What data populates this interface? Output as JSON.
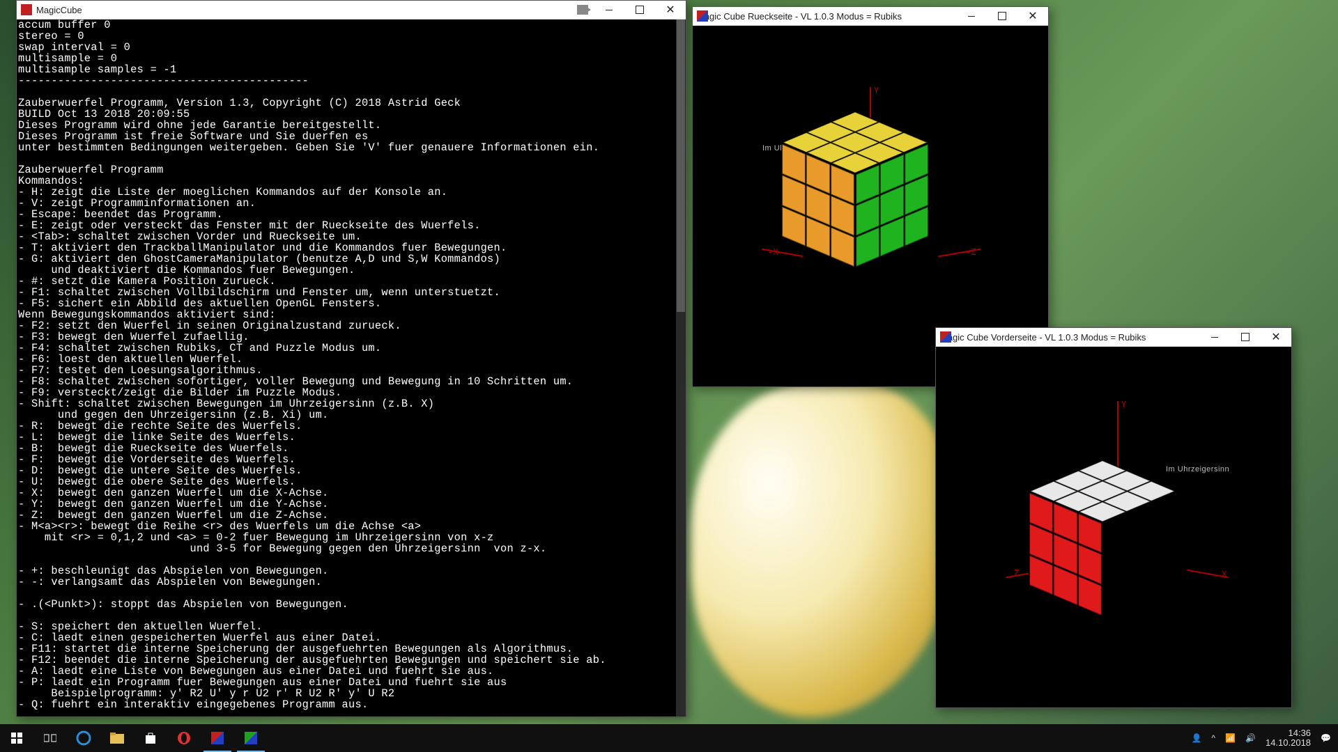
{
  "console_window": {
    "title": "MagicCube",
    "text": "accum buffer 0\nstereo = 0\nswap interval = 0\nmultisample = 0\nmultisample samples = -1\n--------------------------------------------\n\nZauberwuerfel Programm, Version 1.3, Copyright (C) 2018 Astrid Geck\nBUILD Oct 13 2018 20:09:55\nDieses Programm wird ohne jede Garantie bereitgestellt.\nDieses Programm ist freie Software und Sie duerfen es\nunter bestimmten Bedingungen weitergeben. Geben Sie 'V' fuer genauere Informationen ein.\n\nZauberwuerfel Programm\nKommandos:\n- H: zeigt die Liste der moeglichen Kommandos auf der Konsole an.\n- V: zeigt Programminformationen an.\n- Escape: beendet das Programm.\n- E: zeigt oder versteckt das Fenster mit der Rueckseite des Wuerfels.\n- <Tab>: schaltet zwischen Vorder und Rueckseite um.\n- T: aktiviert den TrackballManipulator und die Kommandos fuer Bewegungen.\n- G: aktiviert den GhostCameraManipulator (benutze A,D und S,W Kommandos)\n     und deaktiviert die Kommandos fuer Bewegungen.\n- #: setzt die Kamera Position zurueck.\n- F1: schaltet zwischen Vollbildschirm und Fenster um, wenn unterstuetzt.\n- F5: sichert ein Abbild des aktuellen OpenGL Fensters.\nWenn Bewegungskommandos aktiviert sind:\n- F2: setzt den Wuerfel in seinen Originalzustand zurueck.\n- F3: bewegt den Wuerfel zufaellig.\n- F4: schaltet zwischen Rubiks, CT and Puzzle Modus um.\n- F6: loest den aktuellen Wuerfel.\n- F7: testet den Loesungsalgorithmus.\n- F8: schaltet zwischen sofortiger, voller Bewegung und Bewegung in 10 Schritten um.\n- F9: versteckt/zeigt die Bilder im Puzzle Modus.\n- Shift: schaltet zwischen Bewegungen im Uhrzeigersinn (z.B. X)\n      und gegen den Uhrzeigersinn (z.B. Xi) um.\n- R:  bewegt die rechte Seite des Wuerfels.\n- L:  bewegt die linke Seite des Wuerfels.\n- B:  bewegt die Rueckseite des Wuerfels.\n- F:  bewegt die Vorderseite des Wuerfels.\n- D:  bewegt die untere Seite des Wuerfels.\n- U:  bewegt die obere Seite des Wuerfels.\n- X:  bewegt den ganzen Wuerfel um die X-Achse.\n- Y:  bewegt den ganzen Wuerfel um die Y-Achse.\n- Z:  bewegt den ganzen Wuerfel um die Z-Achse.\n- M<a><r>: bewegt die Reihe <r> des Wuerfels um die Achse <a>\n    mit <r> = 0,1,2 und <a> = 0-2 fuer Bewegung im Uhrzeigersinn von x-z\n                          und 3-5 for Bewegung gegen den Uhrzeigersinn  von z-x.\n\n- +: beschleunigt das Abspielen von Bewegungen.\n- -: verlangsamt das Abspielen von Bewegungen.\n\n- .(<Punkt>): stoppt das Abspielen von Bewegungen.\n\n- S: speichert den aktuellen Wuerfel.\n- C: laedt einen gespeicherten Wuerfel aus einer Datei.\n- F11: startet die interne Speicherung der ausgefuehrten Bewegungen als Algorithmus.\n- F12: beendet die interne Speicherung der ausgefuehrten Bewegungen und speichert sie ab.\n- A: laedt eine Liste von Bewegungen aus einer Datei und fuehrt sie aus.\n- P: laedt ein Programm fuer Bewegungen aus einer Datei und fuehrt sie aus\n     Beispielprogramm: y' R2 U' y r U2 r' R U2 R' y' U R2\n- Q: fuehrt ein interaktiv eingegebenes Programm aus."
  },
  "back_window": {
    "title": "Magic Cube Rueckseite - VL 1.0.3 Modus = Rubiks",
    "hint": "Im Uhrzeigersinn",
    "axes": {
      "y": "Y",
      "nx": "-X",
      "nz": "-Z"
    },
    "faces": {
      "top": {
        "color": "#e8d23a"
      },
      "left": {
        "color": "#e89a2a"
      },
      "right": {
        "color": "#1fb41f"
      }
    }
  },
  "front_window": {
    "title": "Magic Cube Vorderseite - VL 1.0.3 Modus = Rubiks",
    "hint": "Im Uhrzeigersinn",
    "axes": {
      "y": "Y",
      "x": "X",
      "z": "Z"
    },
    "faces": {
      "top": {
        "color": "#e8e8e8"
      },
      "left": {
        "color": "#1a1ae0"
      },
      "right": {
        "color": "#e01a1a"
      }
    }
  },
  "taskbar": {
    "time": "14:36",
    "date": "14.10.2018"
  },
  "colors": {
    "axis": "#a00000"
  }
}
